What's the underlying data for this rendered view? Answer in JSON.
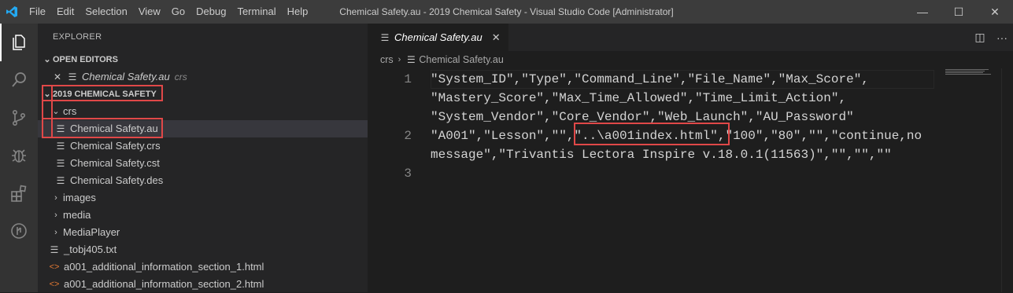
{
  "titlebar": {
    "menu": [
      "File",
      "Edit",
      "Selection",
      "View",
      "Go",
      "Debug",
      "Terminal",
      "Help"
    ],
    "title": "Chemical Safety.au - 2019 Chemical Safety - Visual Studio Code [Administrator]",
    "controls": {
      "minimize": "—",
      "maximize": "☐",
      "close": "✕"
    }
  },
  "activitybar": {
    "icons": [
      "explorer-icon",
      "search-icon",
      "source-control-icon",
      "debug-icon",
      "extensions-icon",
      "remote-icon"
    ]
  },
  "sidebar": {
    "title": "EXPLORER",
    "open_editors": {
      "header": "OPEN EDITORS",
      "items": [
        {
          "name": "Chemical Safety.au",
          "folder": "crs"
        }
      ]
    },
    "workspace": {
      "header": "2019 CHEMICAL SAFETY",
      "crs_folder": "crs",
      "crs_files": [
        "Chemical Safety.au",
        "Chemical Safety.crs",
        "Chemical Safety.cst",
        "Chemical Safety.des"
      ],
      "folders": [
        "images",
        "media",
        "MediaPlayer"
      ],
      "files": [
        {
          "name": "_tobj405.txt",
          "icon": "lines"
        },
        {
          "name": "a001_additional_information_section_1.html",
          "icon": "html"
        },
        {
          "name": "a001_additional_information_section_2.html",
          "icon": "html"
        }
      ]
    }
  },
  "editor": {
    "tab": {
      "label": "Chemical Safety.au",
      "close": "✕"
    },
    "breadcrumb": [
      "crs",
      "Chemical Safety.au"
    ],
    "lines": [
      {
        "number": "1",
        "rows": [
          "\"System_ID\",\"Type\",\"Command_Line\",\"File_Name\",\"Max_Score\",",
          "\"Mastery_Score\",\"Max_Time_Allowed\",\"Time_Limit_Action\",",
          "\"System_Vendor\",\"Core_Vendor\",\"Web_Launch\",\"AU_Password\""
        ]
      },
      {
        "number": "2",
        "rows": [
          "\"A001\",\"Lesson\",\"\",\"..\\a001index.html\",\"100\",\"80\",\"\",\"continue,no",
          "message\",\"Trivantis Lectora Inspire v.18.0.1(11563)\",\"\",\"\",\"\""
        ]
      },
      {
        "number": "3",
        "rows": [
          ""
        ]
      }
    ]
  }
}
